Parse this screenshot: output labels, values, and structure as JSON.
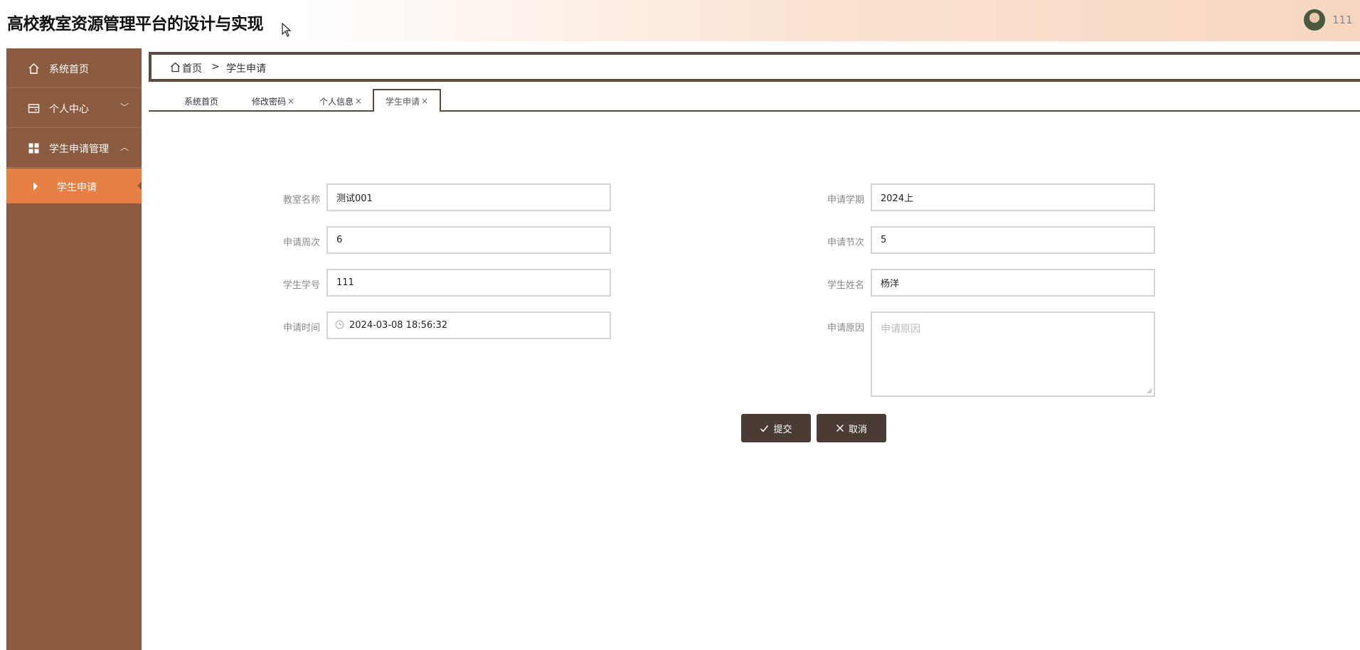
{
  "header": {
    "title": "高校教室资源管理平台的设计与实现",
    "username": "111"
  },
  "sidebar": {
    "items": [
      {
        "label": "系统首页",
        "icon": "home-icon"
      },
      {
        "label": "个人中心",
        "icon": "wallet-icon",
        "chevron": "﹀"
      },
      {
        "label": "学生申请管理",
        "icon": "grid-icon",
        "chevron": "︿"
      }
    ],
    "sub_item": {
      "label": "学生申请"
    }
  },
  "breadcrumb": {
    "home": "首页",
    "separator": ">",
    "current": "学生申请"
  },
  "tabs": [
    {
      "label": "系统首页",
      "closable": false
    },
    {
      "label": "修改密码",
      "closable": true
    },
    {
      "label": "个人信息",
      "closable": true
    },
    {
      "label": "学生申请",
      "closable": true,
      "active": true
    }
  ],
  "tab_close_glyph": "×",
  "form": {
    "classroom_name": {
      "label": "教室名称",
      "value": "测试001"
    },
    "semester": {
      "label": "申请学期",
      "value": "2024上"
    },
    "week": {
      "label": "申请周次",
      "value": "6"
    },
    "period": {
      "label": "申请节次",
      "value": "5"
    },
    "student_id": {
      "label": "学生学号",
      "value": "111"
    },
    "student_name": {
      "label": "学生姓名",
      "value": "杨洋"
    },
    "apply_time": {
      "label": "申请时间",
      "value": "2024-03-08 18:56:32"
    },
    "reason": {
      "label": "申请原因",
      "placeholder": "申请原因"
    }
  },
  "buttons": {
    "submit": {
      "label": "提交",
      "icon": "check-icon"
    },
    "cancel": {
      "label": "取消",
      "icon": "close-icon"
    }
  },
  "colors": {
    "sidebar": "#8b5b40",
    "sidebar_active": "#e98043",
    "accent_dark": "#5d4a3e",
    "button": "#4a3c35"
  }
}
